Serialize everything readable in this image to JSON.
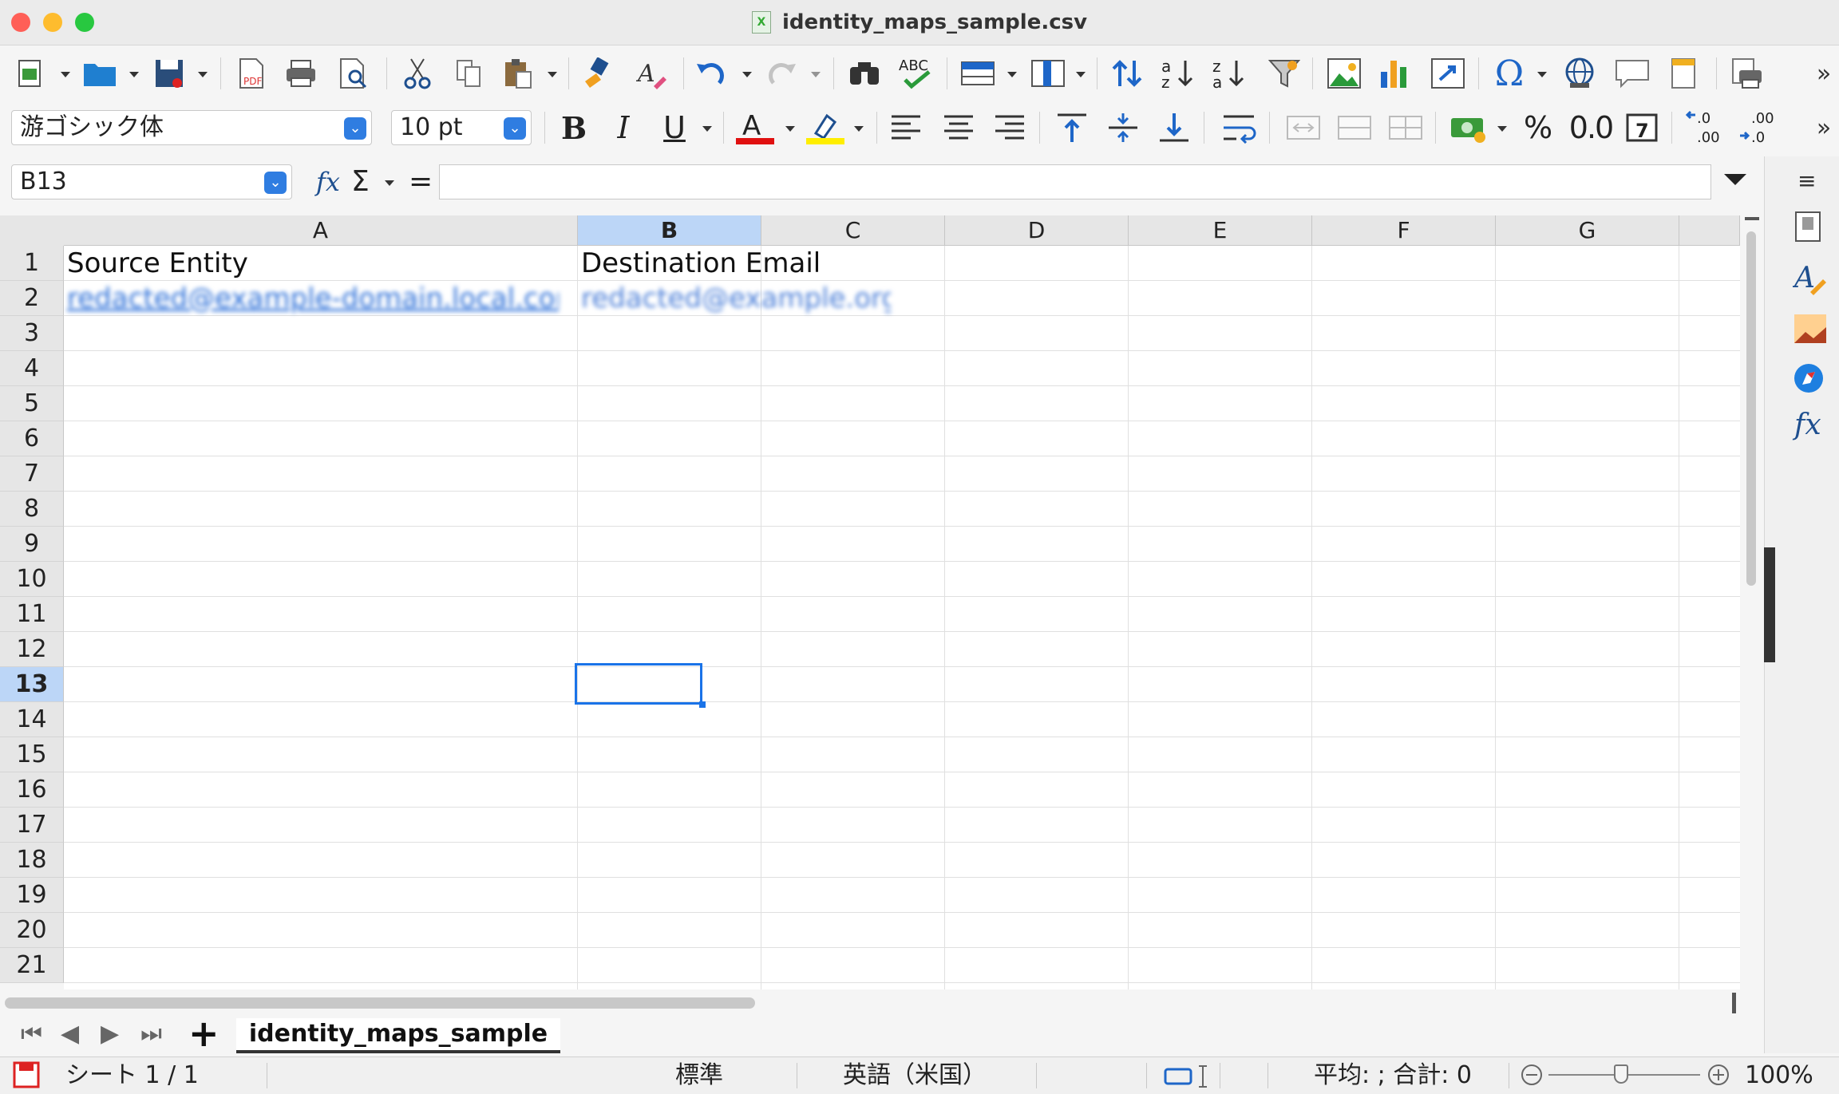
{
  "window": {
    "title": "identity_maps_sample.csv"
  },
  "toolbar2": {
    "font_name": "游ゴシック体",
    "font_size": "10 pt",
    "percent": "%",
    "decimal": "0.0"
  },
  "formula_bar": {
    "name_box": "B13",
    "fx": "fx",
    "sigma": "Σ",
    "equals": "=",
    "content": ""
  },
  "grid": {
    "columns": [
      "A",
      "B",
      "C",
      "D",
      "E",
      "F",
      "G"
    ],
    "rows": [
      "1",
      "2",
      "3",
      "4",
      "5",
      "6",
      "7",
      "8",
      "9",
      "10",
      "11",
      "12",
      "13",
      "14",
      "15",
      "16",
      "17",
      "18",
      "19",
      "20",
      "21"
    ],
    "selected_cell": "B13",
    "cells": {
      "a1": "Source Entity",
      "b1": "Destination Email",
      "a2": "redacted@example-domain.local.com",
      "b2": "redacted@example.org"
    }
  },
  "tabs": {
    "sheet_name": "identity_maps_sample"
  },
  "status": {
    "sheet_count": "シート 1 / 1",
    "style": "標準",
    "language": "英語（米国）",
    "summary": "平均: ; 合計: 0",
    "zoom": "100%"
  },
  "colors": {
    "accent": "#2f7de1",
    "selection": "#1a73e8",
    "header_selected": "#bcd6f7"
  }
}
